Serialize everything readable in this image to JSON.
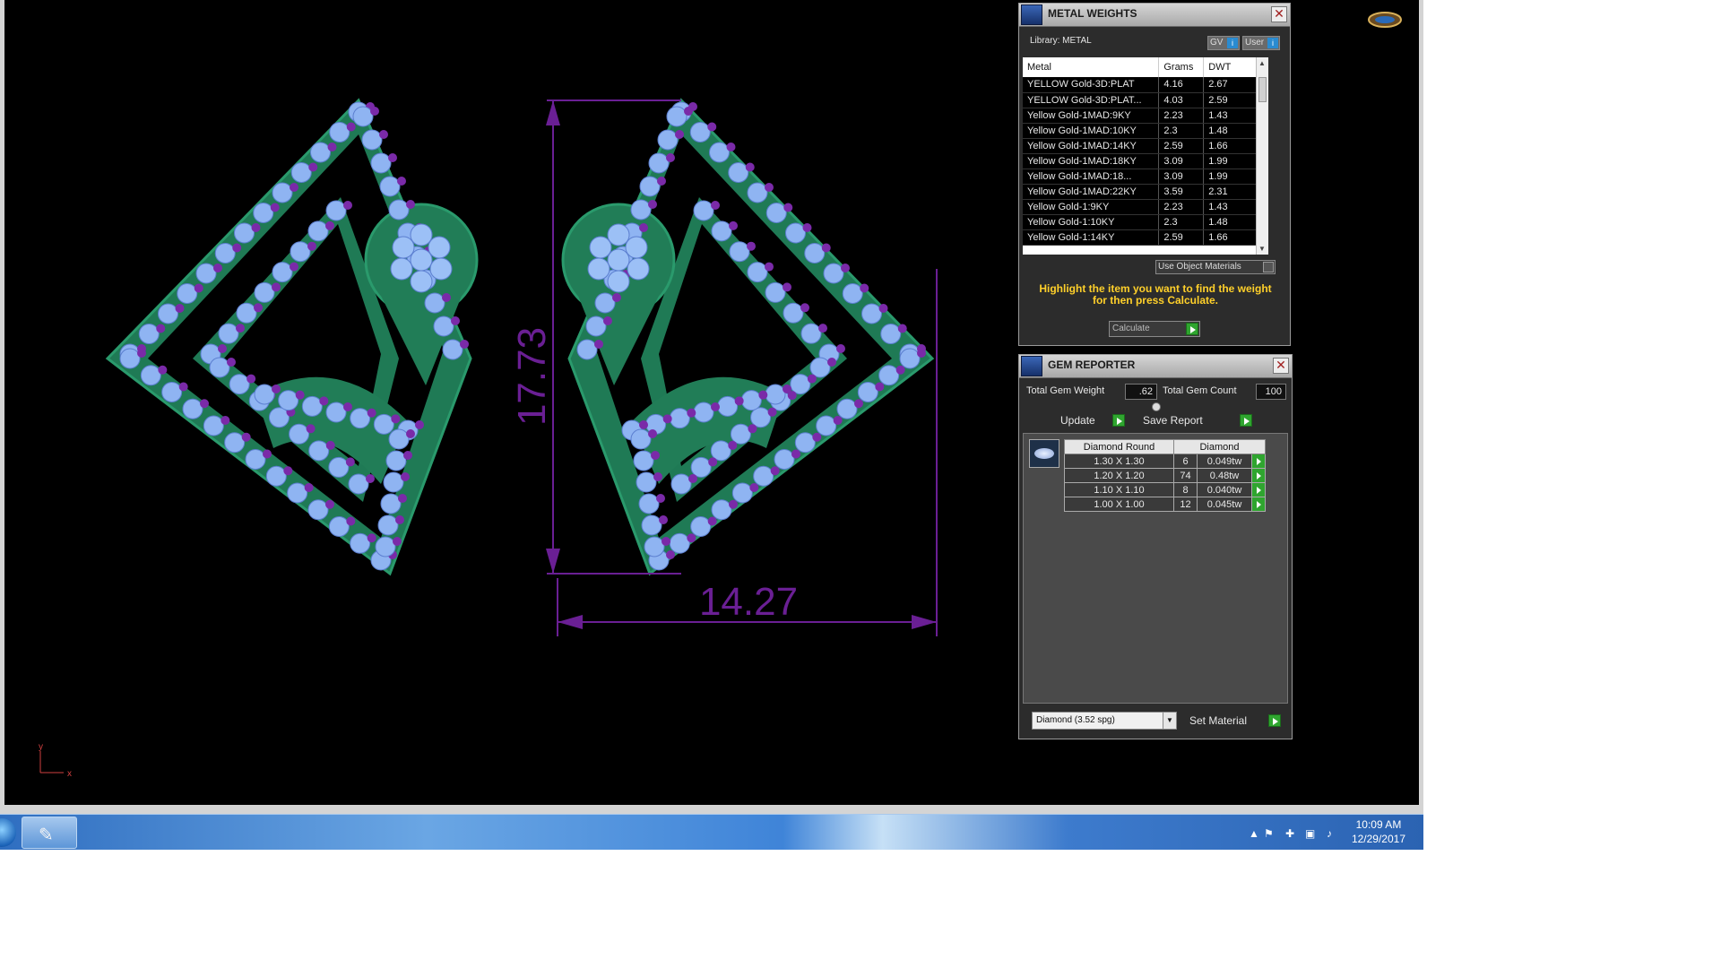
{
  "model": {
    "height_dim": "17.73",
    "width_dim": "14.27",
    "axis_y": "y",
    "axis_x": "x"
  },
  "metal_weights": {
    "title": "METAL WEIGHTS",
    "library_label": "Library: METAL",
    "gv_label": "GV",
    "user_label": "User",
    "columns": [
      "Metal",
      "Grams",
      "DWT"
    ],
    "rows": [
      [
        "YELLOW Gold-3D:PLAT",
        "4.16",
        "2.67"
      ],
      [
        "YELLOW Gold-3D:PLAT...",
        "4.03",
        "2.59"
      ],
      [
        "Yellow Gold-1MAD:9KY",
        "2.23",
        "1.43"
      ],
      [
        "Yellow Gold-1MAD:10KY",
        "2.3",
        "1.48"
      ],
      [
        "Yellow Gold-1MAD:14KY",
        "2.59",
        "1.66"
      ],
      [
        "Yellow Gold-1MAD:18KY",
        "3.09",
        "1.99"
      ],
      [
        "Yellow Gold-1MAD:18...",
        "3.09",
        "1.99"
      ],
      [
        "Yellow Gold-1MAD:22KY",
        "3.59",
        "2.31"
      ],
      [
        "Yellow Gold-1:9KY",
        "2.23",
        "1.43"
      ],
      [
        "Yellow Gold-1:10KY",
        "2.3",
        "1.48"
      ],
      [
        "Yellow Gold-1:14KY",
        "2.59",
        "1.66"
      ]
    ],
    "use_object_materials": "Use Object Materials",
    "hint_line1": "Highlight the item you want to find the weight",
    "hint_line2": "for then press Calculate.",
    "calculate_label": "Calculate"
  },
  "gem_reporter": {
    "title": "GEM REPORTER",
    "total_weight_label": "Total Gem Weight",
    "total_weight_value": ".62",
    "total_count_label": "Total Gem Count",
    "total_count_value": "100",
    "update_label": "Update",
    "save_report_label": "Save Report",
    "columns": [
      "Diamond Round",
      "Diamond"
    ],
    "rows": [
      [
        "1.30 X 1.30",
        "6",
        "0.049tw"
      ],
      [
        "1.20 X 1.20",
        "74",
        "0.48tw"
      ],
      [
        "1.10 X 1.10",
        "8",
        "0.040tw"
      ],
      [
        "1.00 X 1.00",
        "12",
        "0.045tw"
      ]
    ],
    "material_select": "Diamond    (3.52 spg)",
    "set_material_label": "Set Material"
  },
  "taskbar": {
    "time": "10:09 AM",
    "date": "12/29/2017"
  }
}
